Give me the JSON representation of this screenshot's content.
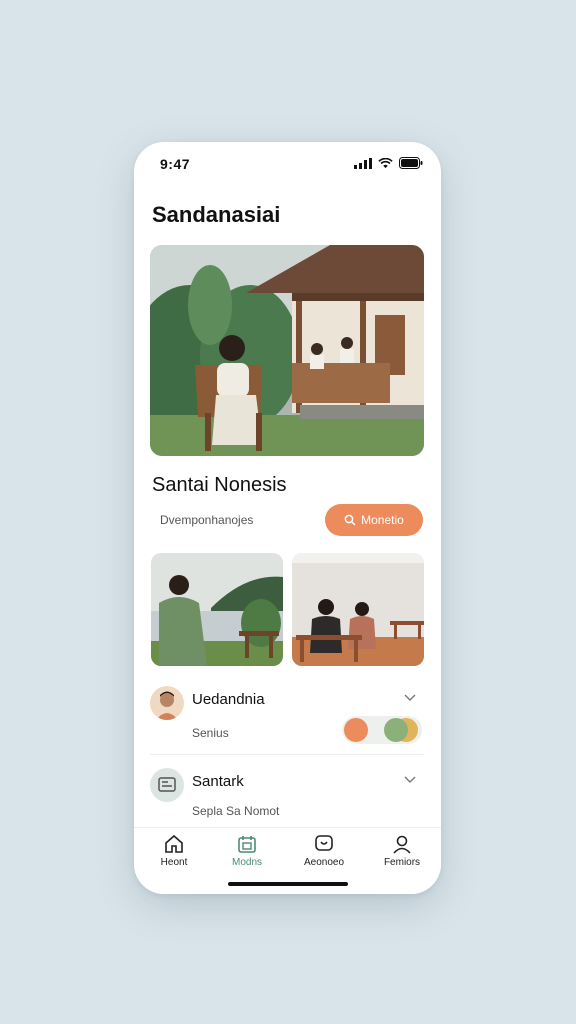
{
  "status_bar": {
    "time": "9:47"
  },
  "app": {
    "title": "Sandanasiai"
  },
  "featured": {
    "title": "Santai Nonesis",
    "subtitle": "Dvemponhanojes",
    "cta_label": "Monetio"
  },
  "list": [
    {
      "title": "Uedandnia",
      "subtitle": "Senius"
    },
    {
      "title": "Santark",
      "subtitle": "Sepla Sa Nomot"
    }
  ],
  "tabs": [
    {
      "label": "Heont",
      "icon": "home-icon"
    },
    {
      "label": "Modns",
      "icon": "calendar-icon"
    },
    {
      "label": "Aeonoeo",
      "icon": "chat-icon"
    },
    {
      "label": "Femiors",
      "icon": "profile-icon"
    }
  ],
  "colors": {
    "accent": "#ec8b5c",
    "active_tab": "#4b8a74",
    "background": "#d9e4ea",
    "toggle_orange": "#ec8b5c",
    "toggle_green": "#8cb07a",
    "toggle_yellow": "#e2b45a"
  }
}
